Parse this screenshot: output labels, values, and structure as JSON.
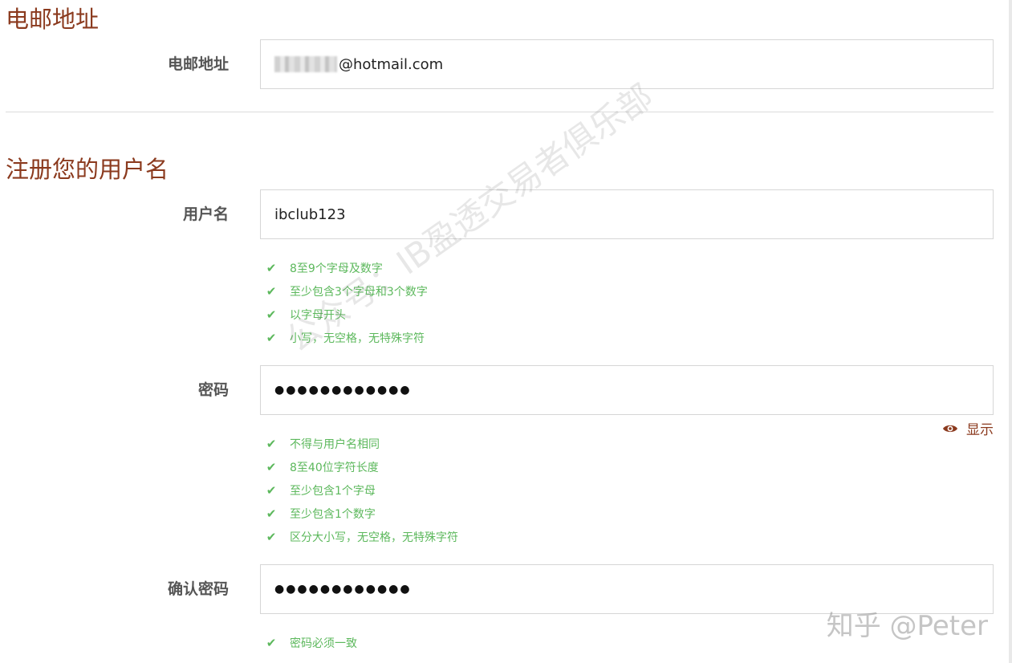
{
  "email_section": {
    "heading": "电邮地址",
    "label": "电邮地址",
    "value_suffix": "@hotmail.com"
  },
  "username_section": {
    "heading": "注册您的用户名",
    "label": "用户名",
    "value": "ibclub123",
    "rules": [
      "8至9个字母及数字",
      "至少包含3个字母和3个数字",
      "以字母开头",
      "小写，无空格，无特殊字符"
    ]
  },
  "password_field": {
    "label": "密码",
    "masked_value": "●●●●●●●●●●●●",
    "show_toggle": "显示",
    "rules": [
      "不得与用户名相同",
      "8至40位字符长度",
      "至少包含1个字母",
      "至少包含1个数字",
      "区分大小写，无空格，无特殊字符"
    ]
  },
  "confirm_password_field": {
    "label": "确认密码",
    "masked_value": "●●●●●●●●●●●●",
    "rules": [
      "密码必须一致"
    ]
  },
  "watermarks": {
    "center": "公众号：IB盈透交易者俱乐部",
    "corner": "知乎 @Peter"
  },
  "colors": {
    "heading": "#8b3a1e",
    "rule_ok": "#5cb85c",
    "label": "#555555",
    "border": "#d6d6d6"
  },
  "icons": {
    "rule_ok": "check-icon",
    "show_password": "eye-icon"
  }
}
